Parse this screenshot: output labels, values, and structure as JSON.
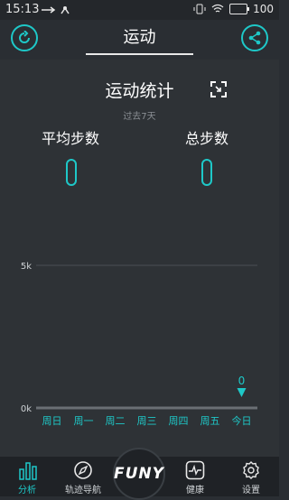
{
  "status": {
    "time": "15:13",
    "battery": "100"
  },
  "header": {
    "title": "运动"
  },
  "stats": {
    "title": "运动统计",
    "subtitle": "过去7天",
    "avg_label": "平均步数",
    "total_label": "总步数",
    "avg_value": "0",
    "total_value": "0"
  },
  "chart_data": {
    "type": "bar",
    "categories": [
      "周日",
      "周一",
      "周二",
      "周三",
      "周四",
      "周五",
      "今日"
    ],
    "values": [
      0,
      0,
      0,
      0,
      0,
      0,
      0
    ],
    "y_ticks": [
      "5k",
      "0k"
    ],
    "ylim": [
      0,
      5000
    ],
    "highlight_label": "0",
    "highlight_index": 6,
    "accent": "#1ec8c8"
  },
  "tabbar": {
    "items": [
      {
        "label": "分析",
        "icon": "bar-chart-icon"
      },
      {
        "label": "轨迹导航",
        "icon": "compass-icon"
      },
      {
        "label": "FUNY",
        "icon": "logo"
      },
      {
        "label": "健康",
        "icon": "heartbeat-icon"
      },
      {
        "label": "设置",
        "icon": "gear-icon"
      }
    ]
  }
}
